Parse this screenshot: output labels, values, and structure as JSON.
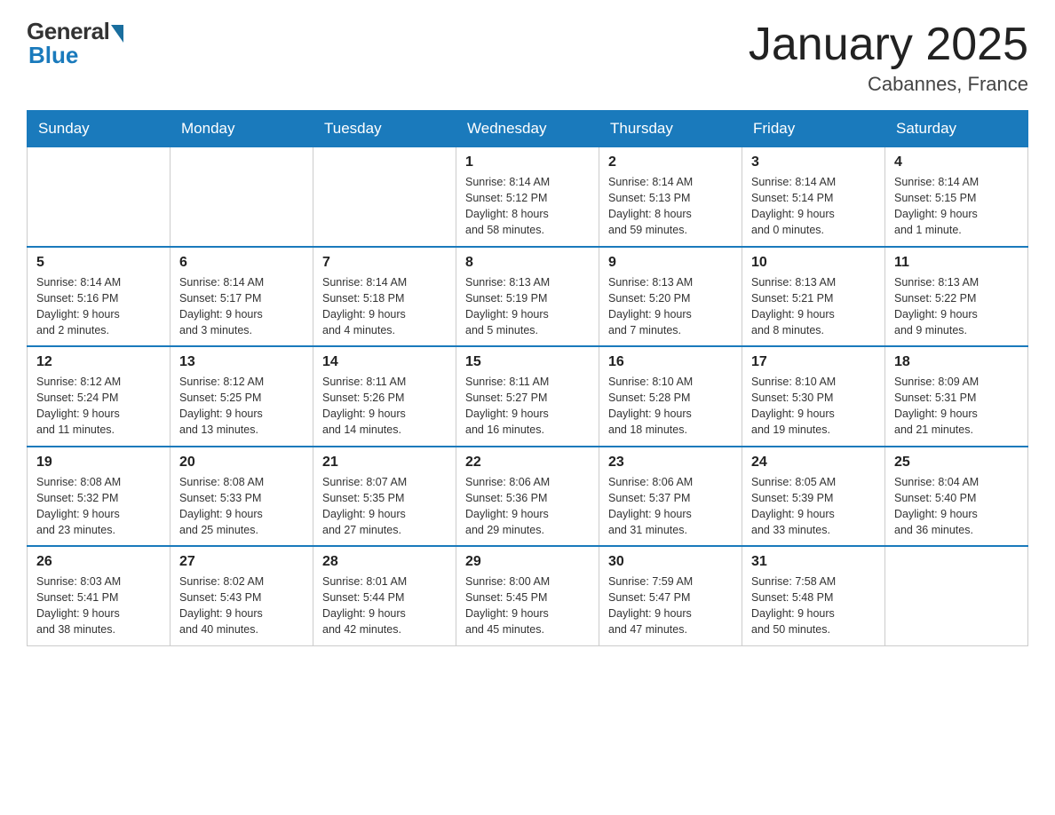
{
  "header": {
    "logo_general": "General",
    "logo_blue": "Blue",
    "title": "January 2025",
    "subtitle": "Cabannes, France"
  },
  "days_of_week": [
    "Sunday",
    "Monday",
    "Tuesday",
    "Wednesday",
    "Thursday",
    "Friday",
    "Saturday"
  ],
  "weeks": [
    {
      "days": [
        {
          "number": "",
          "info": ""
        },
        {
          "number": "",
          "info": ""
        },
        {
          "number": "",
          "info": ""
        },
        {
          "number": "1",
          "info": "Sunrise: 8:14 AM\nSunset: 5:12 PM\nDaylight: 8 hours\nand 58 minutes."
        },
        {
          "number": "2",
          "info": "Sunrise: 8:14 AM\nSunset: 5:13 PM\nDaylight: 8 hours\nand 59 minutes."
        },
        {
          "number": "3",
          "info": "Sunrise: 8:14 AM\nSunset: 5:14 PM\nDaylight: 9 hours\nand 0 minutes."
        },
        {
          "number": "4",
          "info": "Sunrise: 8:14 AM\nSunset: 5:15 PM\nDaylight: 9 hours\nand 1 minute."
        }
      ]
    },
    {
      "days": [
        {
          "number": "5",
          "info": "Sunrise: 8:14 AM\nSunset: 5:16 PM\nDaylight: 9 hours\nand 2 minutes."
        },
        {
          "number": "6",
          "info": "Sunrise: 8:14 AM\nSunset: 5:17 PM\nDaylight: 9 hours\nand 3 minutes."
        },
        {
          "number": "7",
          "info": "Sunrise: 8:14 AM\nSunset: 5:18 PM\nDaylight: 9 hours\nand 4 minutes."
        },
        {
          "number": "8",
          "info": "Sunrise: 8:13 AM\nSunset: 5:19 PM\nDaylight: 9 hours\nand 5 minutes."
        },
        {
          "number": "9",
          "info": "Sunrise: 8:13 AM\nSunset: 5:20 PM\nDaylight: 9 hours\nand 7 minutes."
        },
        {
          "number": "10",
          "info": "Sunrise: 8:13 AM\nSunset: 5:21 PM\nDaylight: 9 hours\nand 8 minutes."
        },
        {
          "number": "11",
          "info": "Sunrise: 8:13 AM\nSunset: 5:22 PM\nDaylight: 9 hours\nand 9 minutes."
        }
      ]
    },
    {
      "days": [
        {
          "number": "12",
          "info": "Sunrise: 8:12 AM\nSunset: 5:24 PM\nDaylight: 9 hours\nand 11 minutes."
        },
        {
          "number": "13",
          "info": "Sunrise: 8:12 AM\nSunset: 5:25 PM\nDaylight: 9 hours\nand 13 minutes."
        },
        {
          "number": "14",
          "info": "Sunrise: 8:11 AM\nSunset: 5:26 PM\nDaylight: 9 hours\nand 14 minutes."
        },
        {
          "number": "15",
          "info": "Sunrise: 8:11 AM\nSunset: 5:27 PM\nDaylight: 9 hours\nand 16 minutes."
        },
        {
          "number": "16",
          "info": "Sunrise: 8:10 AM\nSunset: 5:28 PM\nDaylight: 9 hours\nand 18 minutes."
        },
        {
          "number": "17",
          "info": "Sunrise: 8:10 AM\nSunset: 5:30 PM\nDaylight: 9 hours\nand 19 minutes."
        },
        {
          "number": "18",
          "info": "Sunrise: 8:09 AM\nSunset: 5:31 PM\nDaylight: 9 hours\nand 21 minutes."
        }
      ]
    },
    {
      "days": [
        {
          "number": "19",
          "info": "Sunrise: 8:08 AM\nSunset: 5:32 PM\nDaylight: 9 hours\nand 23 minutes."
        },
        {
          "number": "20",
          "info": "Sunrise: 8:08 AM\nSunset: 5:33 PM\nDaylight: 9 hours\nand 25 minutes."
        },
        {
          "number": "21",
          "info": "Sunrise: 8:07 AM\nSunset: 5:35 PM\nDaylight: 9 hours\nand 27 minutes."
        },
        {
          "number": "22",
          "info": "Sunrise: 8:06 AM\nSunset: 5:36 PM\nDaylight: 9 hours\nand 29 minutes."
        },
        {
          "number": "23",
          "info": "Sunrise: 8:06 AM\nSunset: 5:37 PM\nDaylight: 9 hours\nand 31 minutes."
        },
        {
          "number": "24",
          "info": "Sunrise: 8:05 AM\nSunset: 5:39 PM\nDaylight: 9 hours\nand 33 minutes."
        },
        {
          "number": "25",
          "info": "Sunrise: 8:04 AM\nSunset: 5:40 PM\nDaylight: 9 hours\nand 36 minutes."
        }
      ]
    },
    {
      "days": [
        {
          "number": "26",
          "info": "Sunrise: 8:03 AM\nSunset: 5:41 PM\nDaylight: 9 hours\nand 38 minutes."
        },
        {
          "number": "27",
          "info": "Sunrise: 8:02 AM\nSunset: 5:43 PM\nDaylight: 9 hours\nand 40 minutes."
        },
        {
          "number": "28",
          "info": "Sunrise: 8:01 AM\nSunset: 5:44 PM\nDaylight: 9 hours\nand 42 minutes."
        },
        {
          "number": "29",
          "info": "Sunrise: 8:00 AM\nSunset: 5:45 PM\nDaylight: 9 hours\nand 45 minutes."
        },
        {
          "number": "30",
          "info": "Sunrise: 7:59 AM\nSunset: 5:47 PM\nDaylight: 9 hours\nand 47 minutes."
        },
        {
          "number": "31",
          "info": "Sunrise: 7:58 AM\nSunset: 5:48 PM\nDaylight: 9 hours\nand 50 minutes."
        },
        {
          "number": "",
          "info": ""
        }
      ]
    }
  ]
}
